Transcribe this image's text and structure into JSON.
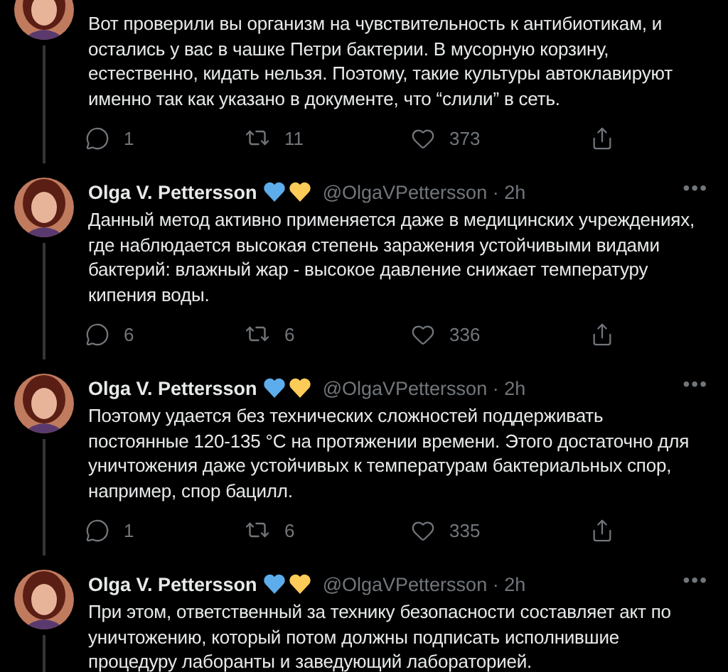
{
  "tweets": [
    {
      "text": "Вот проверили вы организм на чувствительность к антибиотикам, и остались у вас в чашке Петри бактерии. В мусорную корзину, естественно, кидать нельзя. Поэтому, такие культуры автоклавируют именно так как указано в документе, что “слили” в сеть.",
      "thread_line": true,
      "actions": {
        "replies": "1",
        "retweets": "11",
        "likes": "373"
      }
    },
    {
      "author": {
        "name": "Olga V. Pettersson",
        "handle": "@OlgaVPettersson",
        "time": "· 2h"
      },
      "more": "•••",
      "text": "Данный метод активно применяется даже в медицинских учреждениях, где наблюдается высокая степень заражения устойчивыми видами бактерий: влажный жар - высокое давление снижает температуру кипения воды.",
      "thread_line": true,
      "actions": {
        "replies": "6",
        "retweets": "6",
        "likes": "336"
      }
    },
    {
      "author": {
        "name": "Olga V. Pettersson",
        "handle": "@OlgaVPettersson",
        "time": "· 2h"
      },
      "more": "•••",
      "text": "Поэтому удается без технических сложностей поддерживать постоянные 120-135 °C на протяжении времени. Этого достаточно для уничтожения даже устойчивых к температурам бактериальных спор, например, спор бацилл.",
      "thread_line": true,
      "actions": {
        "replies": "1",
        "retweets": "6",
        "likes": "335"
      }
    },
    {
      "author": {
        "name": "Olga V. Pettersson",
        "handle": "@OlgaVPettersson",
        "time": "· 2h"
      },
      "more": "•••",
      "text": "При этом, ответственный за технику безопасности составляет акт по уничтожению, который потом должны подписать исполнившие процедуру лаборанты и заведующий лабораторией.",
      "thread_line": true
    }
  ]
}
